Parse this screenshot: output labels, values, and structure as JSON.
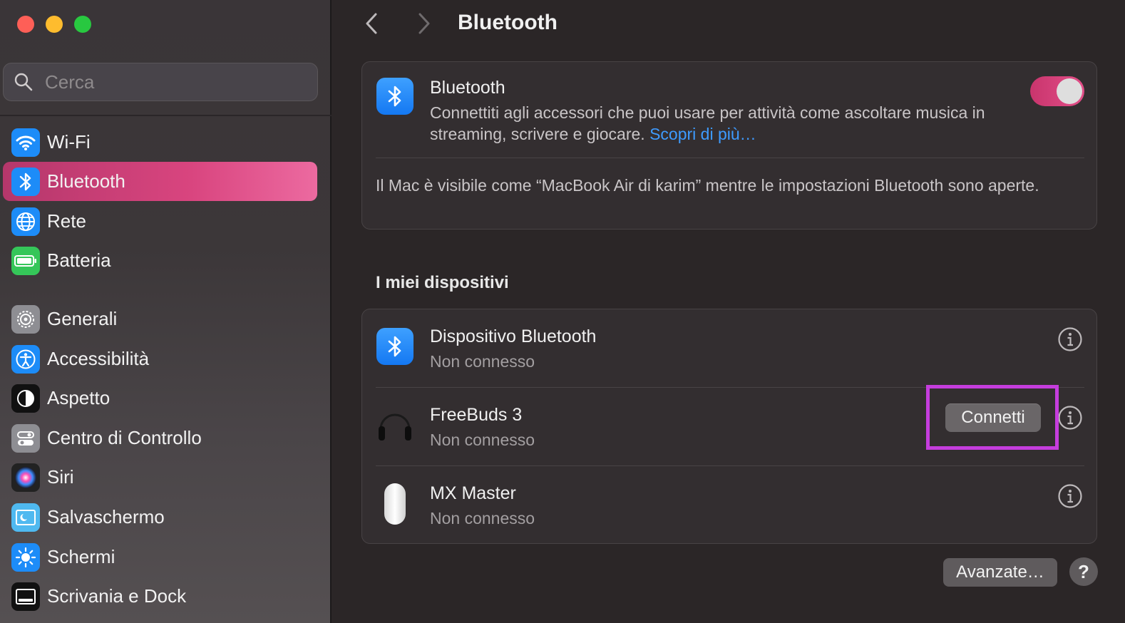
{
  "window": {
    "title": "Bluetooth"
  },
  "sidebar": {
    "search_placeholder": "Cerca",
    "items": [
      {
        "label": "Wi-Fi",
        "icon": "wifi-icon",
        "color": "#1d8cf8",
        "active": false
      },
      {
        "label": "Bluetooth",
        "icon": "bluetooth-icon",
        "color": "#1d8cf8",
        "active": true
      },
      {
        "label": "Rete",
        "icon": "globe-icon",
        "color": "#1d8cf8",
        "active": false
      },
      {
        "label": "Batteria",
        "icon": "battery-icon",
        "color": "#35c659",
        "active": false
      },
      {
        "label": "Generali",
        "icon": "gear-icon",
        "color": "#8e8e93",
        "active": false
      },
      {
        "label": "Accessibilità",
        "icon": "accessibility-icon",
        "color": "#1d8cf8",
        "active": false
      },
      {
        "label": "Aspetto",
        "icon": "appearance-icon",
        "color": "#111111",
        "active": false
      },
      {
        "label": "Centro di Controllo",
        "icon": "control-center-icon",
        "color": "#8e8e93",
        "active": false
      },
      {
        "label": "Siri",
        "icon": "siri-icon",
        "color": "#222222",
        "active": false
      },
      {
        "label": "Salvaschermo",
        "icon": "screensaver-icon",
        "color": "#4fb9f0",
        "active": false
      },
      {
        "label": "Schermi",
        "icon": "sun-icon",
        "color": "#1d8cf8",
        "active": false
      },
      {
        "label": "Scrivania e Dock",
        "icon": "dock-icon",
        "color": "#111111",
        "active": false
      }
    ]
  },
  "main": {
    "bluetooth_card": {
      "title": "Bluetooth",
      "description": "Connettiti agli accessori che puoi usare per attività come ascoltare musica in streaming, scrivere e giocare.",
      "link": "Scopri di più…",
      "toggle_on": true,
      "visibility_note": "Il Mac è visibile come “MacBook Air di karim” mentre le impostazioni Bluetooth sono aperte."
    },
    "devices_section_title": "I miei dispositivi",
    "devices": [
      {
        "name": "Dispositivo Bluetooth",
        "status": "Non connesso",
        "icon": "bluetooth-icon"
      },
      {
        "name": "FreeBuds 3",
        "status": "Non connesso",
        "icon": "earbuds-icon",
        "connect_label": "Connetti"
      },
      {
        "name": "MX Master",
        "status": "Non connesso",
        "icon": "mouse-icon"
      }
    ],
    "advanced_button": "Avanzate…",
    "help_button": "?"
  },
  "colors": {
    "accent": "#d9457f",
    "link": "#3e9bff",
    "highlight": "#c53ddd"
  }
}
